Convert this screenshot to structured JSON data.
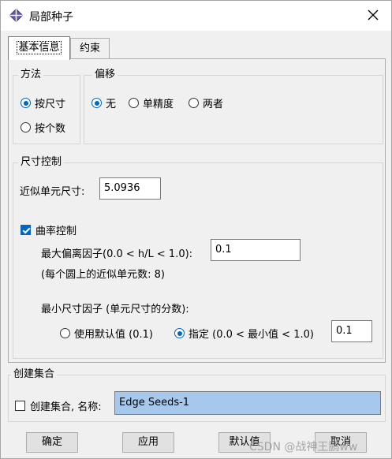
{
  "window": {
    "title": "局部种子"
  },
  "tabs": [
    {
      "label": "基本信息"
    },
    {
      "label": "约束"
    }
  ],
  "method": {
    "title": "方法",
    "options": [
      {
        "label": "按尺寸",
        "selected": true
      },
      {
        "label": "按个数",
        "selected": false
      }
    ]
  },
  "bias": {
    "title": "偏移",
    "options": [
      {
        "label": "无",
        "selected": true
      },
      {
        "label": "单精度",
        "selected": false
      },
      {
        "label": "两者",
        "selected": false
      }
    ]
  },
  "size_control": {
    "title": "尺寸控制",
    "approx_size_label": "近似单元尺寸:",
    "approx_size_value": "5.0936",
    "curvature_label": "曲率控制",
    "curvature_checked": true,
    "max_dev_label": "最大偏离因子(0.0 < h/L < 1.0):",
    "max_dev_value": "0.1",
    "approx_elements_note": "(每个圆上的近似单元数: 8)",
    "min_size_label": "最小尺寸因子 (单元尺寸的分数):",
    "use_default_label": "使用默认值 (0.1)",
    "use_default_selected": false,
    "specify_label": "指定 (0.0 < 最小值 < 1.0)",
    "specify_selected": true,
    "specify_value": "0.1"
  },
  "create_set": {
    "title": "创建集合",
    "checkbox_label": "创建集合, 名称:",
    "checked": false,
    "name_value": "Edge Seeds-1"
  },
  "buttons": {
    "ok": "确定",
    "apply": "应用",
    "defaults": "默认值",
    "cancel": "取消"
  },
  "watermark": "CSDN @战神王鹏ww"
}
